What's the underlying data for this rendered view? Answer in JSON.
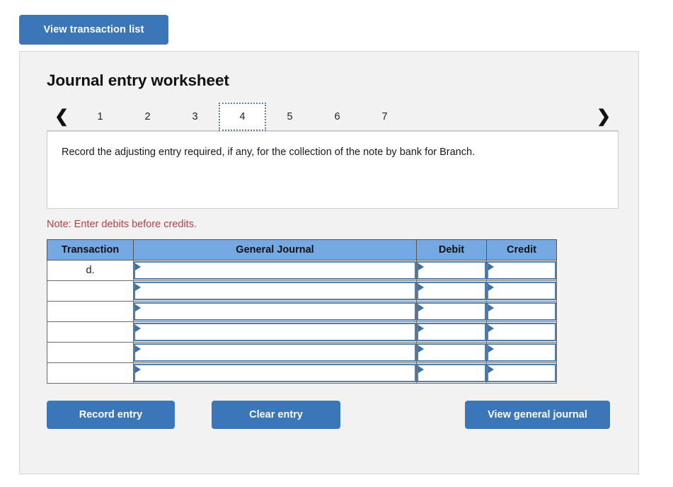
{
  "top_bar": {
    "view_transaction_list_label": "View transaction list"
  },
  "worksheet": {
    "title": "Journal entry worksheet",
    "nav": {
      "prev_icon": "chevron-left-icon",
      "next_icon": "chevron-right-icon",
      "prev_glyph": "❮",
      "next_glyph": "❯",
      "tabs": [
        "1",
        "2",
        "3",
        "4",
        "5",
        "6",
        "7"
      ],
      "active_tab": "4"
    },
    "prompt": "Record the adjusting entry required, if any, for the collection of the note by bank for Branch.",
    "note": "Note: Enter debits before credits."
  },
  "table": {
    "headers": [
      "Transaction",
      "General Journal",
      "Debit",
      "Credit"
    ],
    "rows": [
      {
        "transaction": "d.",
        "general_journal": "",
        "debit": "",
        "credit": ""
      },
      {
        "transaction": "",
        "general_journal": "",
        "debit": "",
        "credit": ""
      },
      {
        "transaction": "",
        "general_journal": "",
        "debit": "",
        "credit": ""
      },
      {
        "transaction": "",
        "general_journal": "",
        "debit": "",
        "credit": ""
      },
      {
        "transaction": "",
        "general_journal": "",
        "debit": "",
        "credit": ""
      },
      {
        "transaction": "",
        "general_journal": "",
        "debit": "",
        "credit": ""
      }
    ]
  },
  "actions": {
    "record_entry_label": "Record entry",
    "clear_entry_label": "Clear entry",
    "view_general_journal_label": "View general journal"
  },
  "colors": {
    "button_blue": "#3a76b8",
    "table_header_blue": "#74a9e3",
    "input_border_blue": "#4d7fb3",
    "note_red": "#ad4442",
    "panel_bg": "#f2f2f2"
  }
}
